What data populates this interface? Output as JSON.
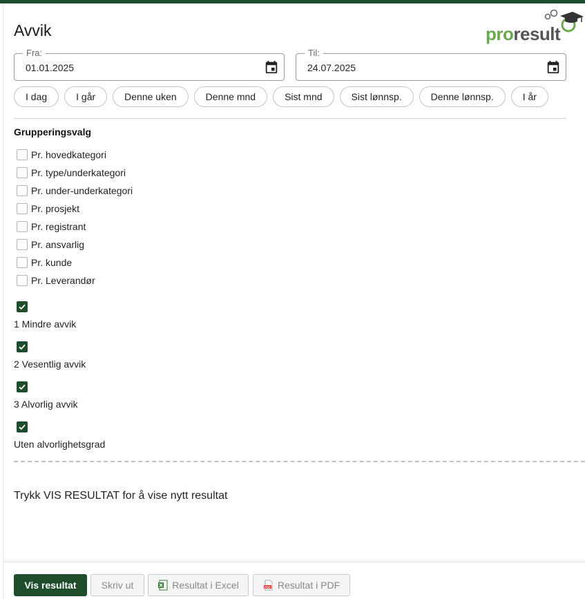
{
  "header": {
    "title": "Avvik",
    "logo": {
      "pro": "pro",
      "result": "result"
    }
  },
  "dates": {
    "from": {
      "label": "Fra:",
      "value": "01.01.2025",
      "icon": "calendar-icon"
    },
    "to": {
      "label": "Til:",
      "value": "24.07.2025",
      "icon": "calendar-icon"
    }
  },
  "quick_ranges": [
    "I dag",
    "I går",
    "Denne uken",
    "Denne mnd",
    "Sist mnd",
    "Sist lønnsp.",
    "Denne lønnsp.",
    "I år"
  ],
  "grouping": {
    "title": "Grupperingsvalg",
    "options": [
      {
        "label": "Pr. hovedkategori",
        "checked": false
      },
      {
        "label": "Pr. type/underkategori",
        "checked": false
      },
      {
        "label": "Pr. under-underkategori",
        "checked": false
      },
      {
        "label": "Pr. prosjekt",
        "checked": false
      },
      {
        "label": "Pr. registrant",
        "checked": false
      },
      {
        "label": "Pr. ansvarlig",
        "checked": false
      },
      {
        "label": "Pr. kunde",
        "checked": false
      },
      {
        "label": "Pr. Leverandør",
        "checked": false
      }
    ]
  },
  "severity": [
    {
      "label": "1 Mindre avvik",
      "checked": true
    },
    {
      "label": "2 Vesentlig avvik",
      "checked": true
    },
    {
      "label": "3 Alvorlig avvik",
      "checked": true
    },
    {
      "label": "Uten alvorlighetsgrad",
      "checked": true
    }
  ],
  "result_message": "Trykk VIS RESULTAT for å vise nytt resultat",
  "footer": {
    "show_result": "Vis resultat",
    "print": "Skriv ut",
    "excel": "Resultat i Excel",
    "pdf": "Resultat i PDF"
  },
  "colors": {
    "primary": "#1e4d2b",
    "logo_green": "#6aa84f"
  }
}
